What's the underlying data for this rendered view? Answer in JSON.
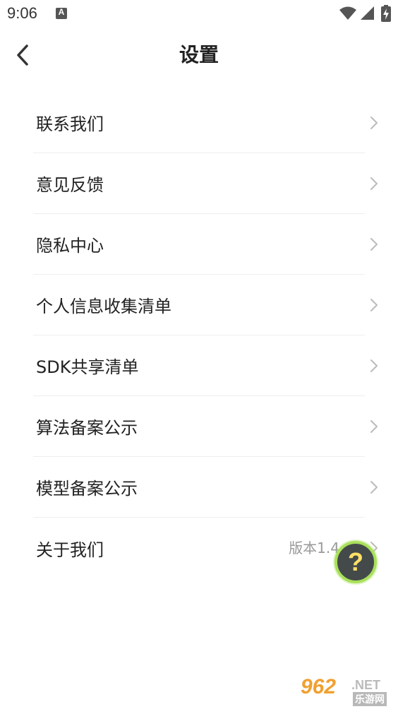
{
  "status_bar": {
    "time": "9:06",
    "notification_icon_letter": "A",
    "icons": [
      "wifi-icon",
      "signal-icon",
      "battery-charging-icon"
    ]
  },
  "header": {
    "title": "设置",
    "back_icon": "chevron-left-icon"
  },
  "settings": {
    "items": [
      {
        "label": "联系我们",
        "value": ""
      },
      {
        "label": "意见反馈",
        "value": ""
      },
      {
        "label": "隐私中心",
        "value": ""
      },
      {
        "label": "个人信息收集清单",
        "value": ""
      },
      {
        "label": "SDK共享清单",
        "value": ""
      },
      {
        "label": "算法备案公示",
        "value": ""
      },
      {
        "label": "模型备案公示",
        "value": ""
      },
      {
        "label": "关于我们",
        "value": "版本1.4"
      }
    ]
  },
  "help_button": {
    "symbol": "?"
  },
  "watermark": {
    "number": "962",
    "net": ".NET",
    "cn": "乐游网"
  },
  "colors": {
    "background": "#ffffff",
    "text": "#222222",
    "muted": "#999999",
    "divider": "#eeeeee",
    "fab_ring": "#a9e15a",
    "fab_fill": "#444a4a",
    "fab_symbol": "#ffe066"
  }
}
